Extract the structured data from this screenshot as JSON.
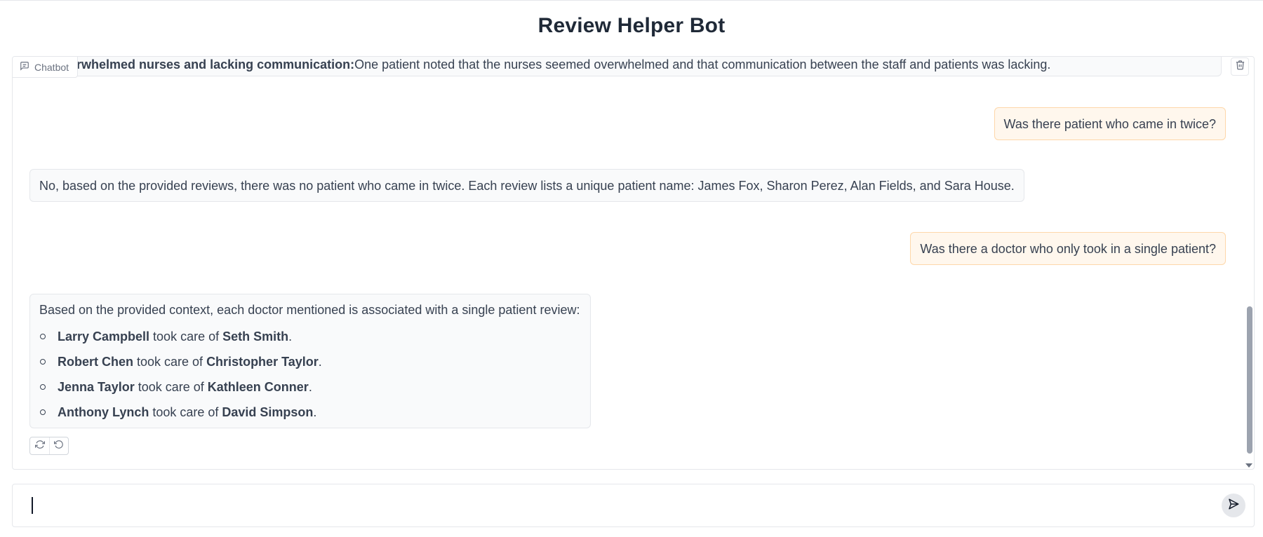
{
  "app": {
    "title": "Review Helper Bot"
  },
  "chat": {
    "label": "Chatbot",
    "messages": [
      {
        "role": "bot",
        "bold": "erwhelmed nurses and lacking communication:",
        "text": " One patient noted that the nurses seemed overwhelmed and that communication between the staff and patients was lacking."
      },
      {
        "role": "user",
        "text": "Was there patient who came in twice?"
      },
      {
        "role": "bot",
        "text": "No, based on the provided reviews, there was no patient who came in twice. Each review lists a unique patient name: James Fox, Sharon Perez, Alan Fields, and Sara House."
      },
      {
        "role": "user",
        "text": "Was there a doctor who only took in a single patient?"
      },
      {
        "role": "bot",
        "intro": "Based on the provided context, each doctor mentioned is associated with a single patient review:",
        "items": [
          {
            "doctor": "Larry Campbell",
            "mid": " took care of ",
            "patient": "Seth Smith",
            "end": "."
          },
          {
            "doctor": "Robert Chen",
            "mid": " took care of ",
            "patient": "Christopher Taylor",
            "end": "."
          },
          {
            "doctor": "Jenna Taylor",
            "mid": " took care of ",
            "patient": "Kathleen Conner",
            "end": "."
          },
          {
            "doctor": "Anthony Lynch",
            "mid": " took care of ",
            "patient": "David Simpson",
            "end": "."
          }
        ]
      }
    ],
    "actions": [
      {
        "icon": "retry-icon"
      },
      {
        "icon": "undo-icon"
      }
    ]
  },
  "input": {
    "value": "",
    "placeholder": ""
  },
  "icons": {
    "label": "chat-bubble-icon",
    "clear": "trash-icon",
    "send": "send-icon"
  },
  "colors": {
    "user_bubble": "#fff7ed",
    "user_border": "#fed7aa",
    "bot_bubble": "#f9fafb",
    "border": "#e5e7eb"
  }
}
